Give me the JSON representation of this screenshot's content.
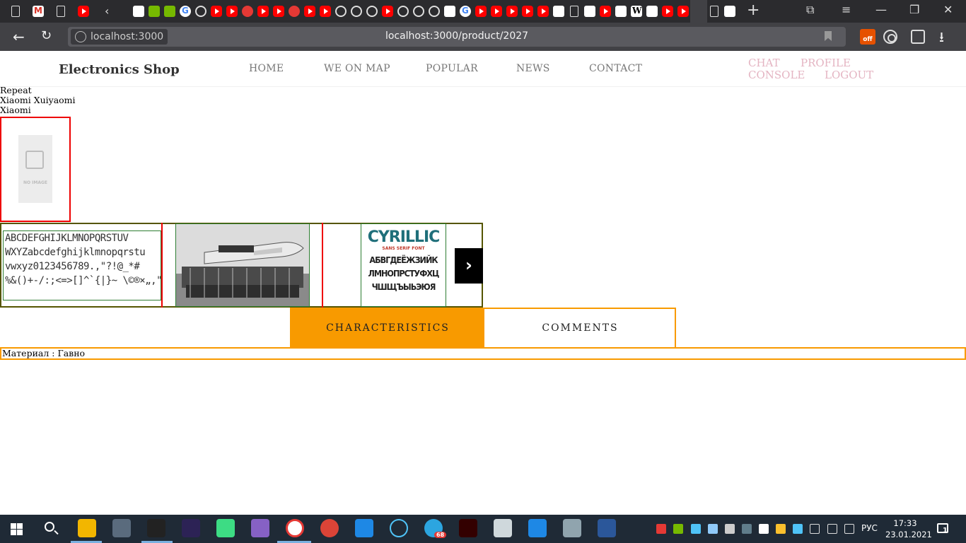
{
  "browser": {
    "url_chip": "localhost:3000",
    "url": "localhost:3000/product/2027",
    "ext_badge": "off",
    "tab_icons": [
      "doc-icon",
      "gmail-icon",
      "doc-icon",
      "youtube-icon",
      "back-icon",
      "readme-icon",
      "nvidia-icon",
      "nvidia-icon",
      "google-icon",
      "github-icon",
      "youtube-icon",
      "youtube-icon",
      "target-icon",
      "youtube-icon",
      "youtube-icon",
      "vivaldi-icon",
      "youtube-icon",
      "youtube-icon",
      "github-icon",
      "github-icon",
      "github-icon",
      "youtube-icon",
      "github-icon",
      "github-icon",
      "github-icon",
      "ao3-icon",
      "google-icon",
      "youtube-icon",
      "youtube-icon",
      "youtube-icon",
      "youtube-icon",
      "youtube-icon",
      "leaf-icon",
      "doc-icon",
      "ao3-icon",
      "youtube-icon",
      "quora-icon",
      "wikipedia-icon",
      "ao3-icon",
      "youtube-icon",
      "youtube-icon",
      "youtube-icon",
      "doc-icon",
      "edge-icon",
      "steam-icon"
    ]
  },
  "header": {
    "brand": "Electronics Shop",
    "nav": [
      "HOME",
      "WE ON MAP",
      "POPULAR",
      "NEWS",
      "CONTACT"
    ],
    "user_links": {
      "chat": "CHAT",
      "profile": "PROFILE",
      "console": "CONSOLE",
      "logout": "LOGOUT"
    }
  },
  "product": {
    "line1": "Repeat",
    "line2": "Xiaomi Xuiyaomi",
    "line3": "Xiaomi",
    "no_image_text": "NO IMAGE"
  },
  "carousel": {
    "slide1_lines": [
      "ABCDEFGHIJKLMNOPQRSTUV",
      "WXYZabcdefghijklmnopqrstu",
      "vwxyz0123456789.,\"?!@_*#",
      "%&()+-/:;<=>[]^`{|}~ \\©®×„‚\"¶ÞẞÐ"
    ],
    "slide3_title": "CYRILLIC",
    "slide3_subtitle": "SANS SERIF FONT",
    "slide3_lines": [
      "АБВГДЕЁЖЗИЙК",
      "ЛМНОПРСТУФХЦ",
      "ЧШЩЪЫЬЭЮЯ"
    ],
    "next_symbol": "›"
  },
  "tabs": {
    "characteristics": "CHARACTERISTICS",
    "comments": "COMMENTS"
  },
  "properties": {
    "material": "Материал : Гавно"
  },
  "taskbar": {
    "lang": "РУС",
    "time": "17:33",
    "date": "23.01.2021",
    "notifications": "1",
    "telegram_badge": "68",
    "apps": [
      "explorer-icon",
      "calculator-icon",
      "instruments-icon",
      "eclipse-icon",
      "android-studio-icon",
      "visual-studio-icon",
      "yandex-browser-icon",
      "chrome-icon",
      "vscode-icon",
      "joxi-icon",
      "telegram-icon",
      "illustrator-icon",
      "excel-icon",
      "upload-icon",
      "photos-icon",
      "word-icon"
    ]
  },
  "colors": {
    "accent": "#f89a00",
    "red": "#ee0000",
    "user_link": "#e4b4c2"
  }
}
